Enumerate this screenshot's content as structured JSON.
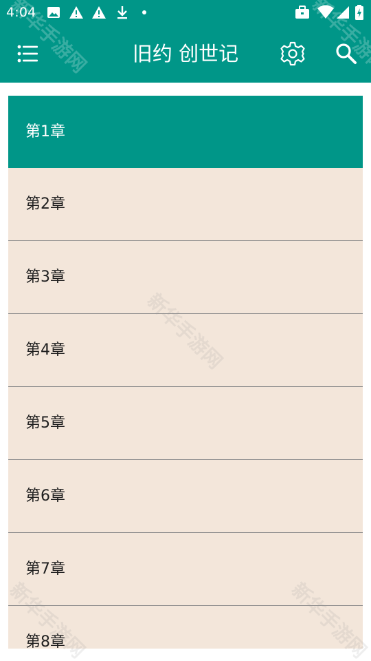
{
  "status_bar": {
    "time": "4:04",
    "icons": [
      "image-icon",
      "warning-icon",
      "warning-icon",
      "download-icon",
      "dot-icon",
      "briefcase-icon",
      "wifi-icon",
      "signal-icon",
      "battery-icon"
    ]
  },
  "app_bar": {
    "title": "旧约 创世记",
    "menu_icon": "menu-icon",
    "settings_icon": "gear-icon",
    "search_icon": "search-icon",
    "color": "#009688"
  },
  "chapters": {
    "items": [
      {
        "label": "第1章",
        "selected": true
      },
      {
        "label": "第2章",
        "selected": false
      },
      {
        "label": "第3章",
        "selected": false
      },
      {
        "label": "第4章",
        "selected": false
      },
      {
        "label": "第5章",
        "selected": false
      },
      {
        "label": "第6章",
        "selected": false
      },
      {
        "label": "第7章",
        "selected": false
      },
      {
        "label": "第8章",
        "selected": false
      }
    ],
    "selected_color": "#009688",
    "item_color": "#f3e6da"
  },
  "watermark": {
    "text": "新华手游网"
  }
}
